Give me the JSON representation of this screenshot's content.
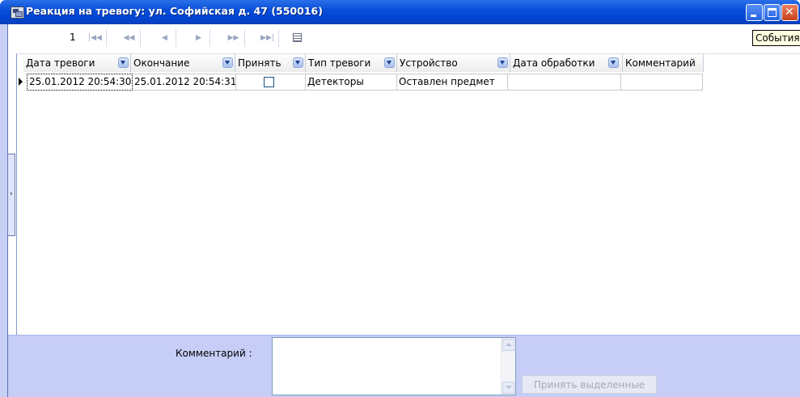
{
  "window": {
    "title": "Реакция на тревогу: ул. Софийская д. 47 (550016)",
    "tooltip": "События",
    "close_glyph": "✕"
  },
  "navigator": {
    "record_number": "1",
    "icons": [
      "first-record-icon",
      "previous-page-icon",
      "previous-record-icon",
      "next-record-icon",
      "next-page-icon",
      "last-record-icon",
      "grid-columns-icon"
    ]
  },
  "grid": {
    "columns": [
      "Дата тревоги",
      "Окончание",
      "Принять",
      "Тип тревоги",
      "Устройство",
      "Дата обработки",
      "Комментарий"
    ],
    "rows": [
      {
        "date_alarm": "25.01.2012 20:54:30",
        "end": "25.01.2012 20:54:31",
        "accept_checked": false,
        "alarm_type": "Детекторы",
        "device": "Оставлен предмет",
        "processed_date": "",
        "comment": ""
      }
    ]
  },
  "bottom": {
    "comment_label": "Комментарий :",
    "comment_value": "",
    "accept_button": "Принять выделенные"
  },
  "colors": {
    "title_bar": "#0a4fd8",
    "bottom_panel": "#c6cdf6",
    "close_button": "#c8401c"
  }
}
